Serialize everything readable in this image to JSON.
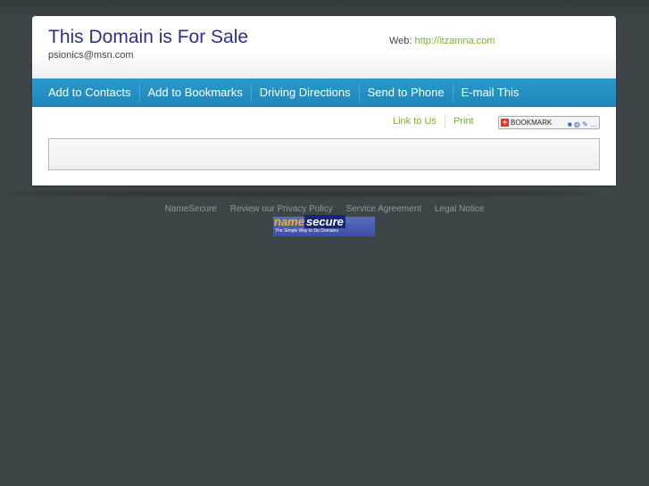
{
  "header": {
    "title": "This Domain is For Sale",
    "email": "psionics@msn.com",
    "web_label": "Web:",
    "web_url": "http://itzamna.com"
  },
  "nav": {
    "items": [
      {
        "label": "Add to Contacts"
      },
      {
        "label": "Add to Bookmarks"
      },
      {
        "label": "Driving Directions"
      },
      {
        "label": "Send to Phone"
      },
      {
        "label": "E-mail This"
      }
    ]
  },
  "tools": {
    "link_to_us": "Link to Us",
    "print": "Print",
    "bookmark_label": "BOOKMARK",
    "bookmark_icon": "plus-icon"
  },
  "footer": {
    "links": [
      {
        "label": "NameSecure"
      },
      {
        "label": "Review our Privacy Policy"
      },
      {
        "label": "Service Agreement"
      },
      {
        "label": "Legal Notice"
      }
    ],
    "logo_name": "name",
    "logo_secure": "secure",
    "logo_tagline": "The Simple Way to Do Domains"
  },
  "colors": {
    "title": "#2b2f8f",
    "link": "#7ab51d",
    "nav_bg": "#1f86b8",
    "page_bg": "#3d4448"
  }
}
